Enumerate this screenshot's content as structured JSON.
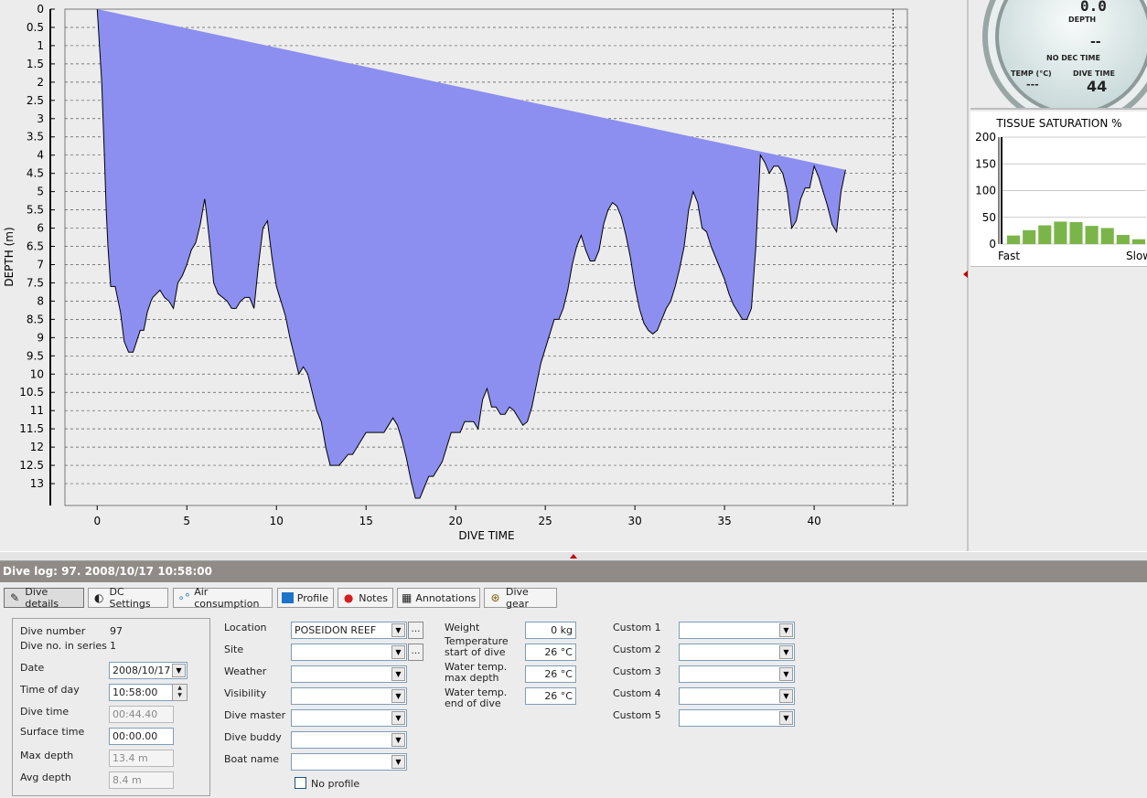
{
  "chart_data": {
    "type": "area",
    "xlabel": "DIVE TIME",
    "ylabel": "DEPTH (m)",
    "xlim": [
      -1.8,
      45.2
    ],
    "ylim": [
      0,
      13.6
    ],
    "y_inverted": true,
    "x_ticks": [
      0,
      5,
      10,
      15,
      20,
      25,
      30,
      35,
      40
    ],
    "y_ticks": [
      "0",
      "0.5",
      "1",
      "1.5",
      "2",
      "2.5",
      "3",
      "3.5",
      "4",
      "4.5",
      "5",
      "5.5",
      "6",
      "6.5",
      "7",
      "7.5",
      "8",
      "8.5",
      "9",
      "9.5",
      "10",
      "10.5",
      "11",
      "11.5",
      "12",
      "12.5",
      "13"
    ],
    "grid": "horizontal dashed",
    "fill_color": "#8c8ef0",
    "x": [
      0,
      0.25,
      0.4,
      0.5,
      0.6,
      0.75,
      1.0,
      1.3,
      1.5,
      1.75,
      2.0,
      2.2,
      2.4,
      2.6,
      2.8,
      3.0,
      3.1,
      3.5,
      3.75,
      4.0,
      4.25,
      4.5,
      4.75,
      5.0,
      5.25,
      5.5,
      5.75,
      6.0,
      6.1,
      6.3,
      6.5,
      6.75,
      7.0,
      7.25,
      7.5,
      7.75,
      8.0,
      8.25,
      8.5,
      8.75,
      9.0,
      9.25,
      9.5,
      9.75,
      10.0,
      10.25,
      10.5,
      10.75,
      11.0,
      11.25,
      11.5,
      11.75,
      12.0,
      12.25,
      12.5,
      12.75,
      13.0,
      13.25,
      13.5,
      14.0,
      14.25,
      14.5,
      14.75,
      15.0,
      15.25,
      15.5,
      15.75,
      16.0,
      16.25,
      16.5,
      16.75,
      17.0,
      17.25,
      17.5,
      17.75,
      18.0,
      18.25,
      18.5,
      18.75,
      19.0,
      19.25,
      19.5,
      19.75,
      20.0,
      20.25,
      20.5,
      20.75,
      21.0,
      21.25,
      21.5,
      21.75,
      22.0,
      22.25,
      22.5,
      22.75,
      23.0,
      23.25,
      23.5,
      23.75,
      24.0,
      24.25,
      24.5,
      24.75,
      25.0,
      25.25,
      25.5,
      25.75,
      26.0,
      26.25,
      26.5,
      26.75,
      27.0,
      27.25,
      27.5,
      27.75,
      28.0,
      28.25,
      28.5,
      28.75,
      29.0,
      29.25,
      29.5,
      29.75,
      30.0,
      30.25,
      30.5,
      30.75,
      31.0,
      31.25,
      31.5,
      31.75,
      32.0,
      32.25,
      32.5,
      32.75,
      33.0,
      33.25,
      33.5,
      33.75,
      34.0,
      34.25,
      34.5,
      34.75,
      35.0,
      35.25,
      35.5,
      35.75,
      36.0,
      36.25,
      36.5,
      36.75,
      37.0,
      37.25,
      37.5,
      37.75,
      38.0,
      38.25,
      38.5,
      38.75,
      39.0,
      39.25,
      39.5,
      39.75,
      40.0,
      40.25,
      40.5,
      40.75,
      41.0,
      41.25,
      41.5,
      41.75,
      42.0,
      42.25,
      42.5,
      42.75,
      43.0,
      43.25,
      43.5,
      43.75,
      44.0,
      44.25,
      44.4
    ],
    "y": [
      0,
      2.0,
      4.0,
      5.5,
      6.5,
      7.6,
      7.6,
      8.3,
      9.1,
      9.4,
      9.4,
      9.1,
      8.8,
      8.8,
      8.3,
      8.0,
      7.9,
      7.7,
      7.9,
      8.0,
      8.2,
      7.5,
      7.3,
      7.0,
      6.6,
      6.4,
      5.9,
      5.2,
      5.6,
      6.5,
      7.5,
      7.8,
      7.9,
      8.0,
      8.2,
      8.2,
      8.0,
      7.9,
      7.9,
      8.2,
      7.0,
      6.0,
      5.8,
      6.8,
      7.6,
      8.0,
      8.4,
      9.0,
      9.5,
      10.0,
      9.8,
      10.0,
      10.5,
      11.0,
      11.3,
      12.0,
      12.5,
      12.5,
      12.5,
      12.2,
      12.2,
      12.0,
      11.8,
      11.6,
      11.6,
      11.6,
      11.6,
      11.6,
      11.4,
      11.2,
      11.4,
      11.8,
      12.3,
      12.9,
      13.4,
      13.4,
      13.1,
      12.8,
      12.8,
      12.6,
      12.4,
      12.0,
      11.6,
      11.6,
      11.6,
      11.3,
      11.3,
      11.3,
      11.5,
      10.7,
      10.4,
      10.9,
      10.9,
      11.1,
      11.1,
      10.9,
      11.0,
      11.2,
      11.4,
      11.3,
      10.9,
      10.3,
      9.7,
      9.3,
      8.9,
      8.5,
      8.5,
      8.2,
      7.7,
      7.0,
      6.5,
      6.2,
      6.6,
      6.9,
      6.9,
      6.6,
      5.9,
      5.5,
      5.3,
      5.4,
      5.7,
      6.2,
      6.8,
      7.6,
      8.2,
      8.6,
      8.8,
      8.9,
      8.8,
      8.5,
      8.2,
      8.0,
      7.6,
      7.1,
      6.5,
      5.5,
      5.0,
      5.3,
      6.0,
      6.1,
      6.5,
      6.8,
      7.1,
      7.4,
      7.8,
      8.1,
      8.3,
      8.5,
      8.5,
      8.2,
      6.5,
      4.0,
      4.2,
      4.5,
      4.3,
      4.3,
      4.5,
      5.0,
      6.0,
      5.8,
      5.2,
      4.9,
      4.9,
      4.3,
      4.6,
      5.0,
      5.4,
      5.9,
      6.1,
      5.0,
      4.4
    ],
    "end_time": 44.4
  },
  "gauge": {
    "depth_value": "0.0",
    "depth_label": "DEPTH",
    "ndl_value": "--",
    "ndl_label": "NO DEC TIME",
    "temp_label": "TEMP (°C)",
    "temp_value": "---",
    "dive_time_label": "DIVE TIME",
    "dive_time_value": "44"
  },
  "tissue": {
    "title": "TISSUE SATURATION %",
    "y_ticks": [
      "200",
      "150",
      "100",
      "50",
      "0"
    ],
    "ymax": 200,
    "x_left": "Fast",
    "x_right": "Slow",
    "bars": [
      16,
      26,
      35,
      42,
      41,
      34,
      30,
      17,
      9
    ],
    "bar_color": "#7bb54a"
  },
  "log_header": "Dive log: 97. 2008/10/17 10:58:00",
  "tabs": [
    {
      "label": "Dive details",
      "icon": "pen-icon",
      "active": true
    },
    {
      "label": "DC Settings",
      "icon": "dc-settings-icon"
    },
    {
      "label": "Air consumption",
      "icon": "bubbles-icon"
    },
    {
      "label": "Profile",
      "icon": "profile-icon"
    },
    {
      "label": "Notes",
      "icon": "pin-icon"
    },
    {
      "label": "Annotations",
      "icon": "annotations-icon"
    },
    {
      "label": "Dive gear",
      "icon": "dive-gear-icon"
    }
  ],
  "details": {
    "dive_number_label": "Dive number",
    "dive_number_value": "97",
    "series_label": "Dive no. in series",
    "series_value": "1",
    "date_label": "Date",
    "date_value": "2008/10/17",
    "time_label": "Time of day",
    "time_value": "10:58:00",
    "dive_time_label": "Dive time",
    "dive_time_value": "00:44.40",
    "surface_time_label": "Surface time",
    "surface_time_value": "00:00.00",
    "max_depth_label": "Max depth",
    "max_depth_value": "13.4 m",
    "avg_depth_label": "Avg depth",
    "avg_depth_value": "8.4 m"
  },
  "location": {
    "location_label": "Location",
    "location_value": "POSEIDON REEF",
    "site_label": "Site",
    "weather_label": "Weather",
    "visibility_label": "Visibility",
    "dive_master_label": "Dive master",
    "dive_buddy_label": "Dive buddy",
    "boat_name_label": "Boat name",
    "no_profile_label": "No profile"
  },
  "conditions": {
    "weight_label": "Weight",
    "weight_value": "0 kg",
    "temp_start_label_1": "Temperature",
    "temp_start_label_2": "start of dive",
    "temp_start_value": "26 °C",
    "temp_max_label_1": "Water temp.",
    "temp_max_label_2": "max depth",
    "temp_max_value": "26 °C",
    "temp_end_label_1": "Water temp.",
    "temp_end_label_2": "end of dive",
    "temp_end_value": "26 °C"
  },
  "custom": {
    "labels": [
      "Custom 1",
      "Custom 2",
      "Custom 3",
      "Custom 4",
      "Custom 5"
    ]
  }
}
